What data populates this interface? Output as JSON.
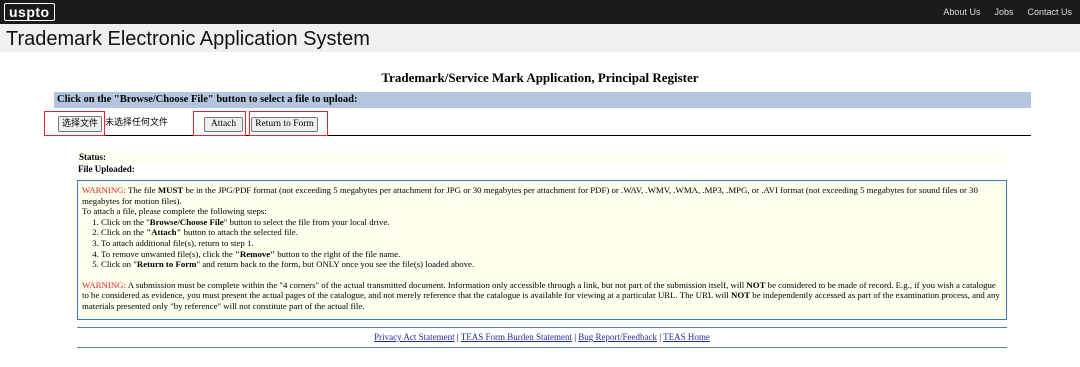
{
  "topbar": {
    "logo": "uspto",
    "nav": [
      "About Us",
      "Jobs",
      "Contact Us"
    ]
  },
  "header": {
    "title": "Trademark Electronic Application System"
  },
  "main": {
    "page_title": "Trademark/Service Mark Application, Principal Register",
    "instruction": "Click on the \"Browse/Choose File\" button to select a file to upload:",
    "choose_file_button": "选择文件",
    "no_file_text": "未选择任何文件",
    "attach_button": "Attach",
    "return_button": "Return to Form",
    "status_label": "Status:",
    "file_uploaded_label": "File Uploaded:"
  },
  "warning_box": {
    "warning_label": "WARNING:",
    "p1_a": " The file ",
    "p1_must": "MUST",
    "p1_b": " be in the JPG/PDF format (not exceeding 5 megabytes per attachment for JPG or 30 megabytes per attachment for PDF) or .WAV, .WMV, .WMA, .MP3, .MPG, or .AVI format (not exceeding 5 megabytes for sound files or 30 megabytes for motion files).",
    "steps_intro": "To attach a file, please complete the following steps:",
    "step1_a": "Click on the \"",
    "step1_b": "Browse/Choose File",
    "step1_c": "\" button to select the file from your local drive.",
    "step2_a": "Click on the ",
    "step2_b": "\"Attach\"",
    "step2_c": " button to attach the selected file.",
    "step3": "To attach additional file(s), return to step 1.",
    "step4_a": "To remove unwanted file(s), click the ",
    "step4_b": "\"Remove\"",
    "step4_c": " button to the right of the file name.",
    "step5_a": "Click on \"",
    "step5_b": "Return to Form",
    "step5_c": "\" and return back to the form, but ONLY once you see the file(s) loaded above.",
    "p2_warning": "WARNING:",
    "p2_a": " A submission must be complete within the \"4 corners\" of the actual transmitted document. Information only accessible through a link, but not part of the submission itself, will ",
    "p2_not1": "NOT",
    "p2_b": " be considered to be made of record. E.g., if you wish a catalogue to be considered as evidence, you must present the actual pages of the catalogue, and not merely reference that the catalogue is available for viewing at a particular URL. The URL will ",
    "p2_not2": "NOT",
    "p2_c": " be independently accessed as part of the examination process, and any materials presented only \"by reference\" will not constitute part of the actual file."
  },
  "footer": {
    "links": [
      "Privacy Act Statement",
      "TEAS Form Burden Statement",
      "Bug Report/Feedback",
      "TEAS Home"
    ],
    "separator": " | "
  },
  "colors": {
    "topbar_bg": "#1a1a1a",
    "instruction_bar": "#b3c6dd",
    "highlight_box": "#e8212a",
    "warning_border": "#3a7cb6",
    "warning_red": "#d21f2a"
  }
}
